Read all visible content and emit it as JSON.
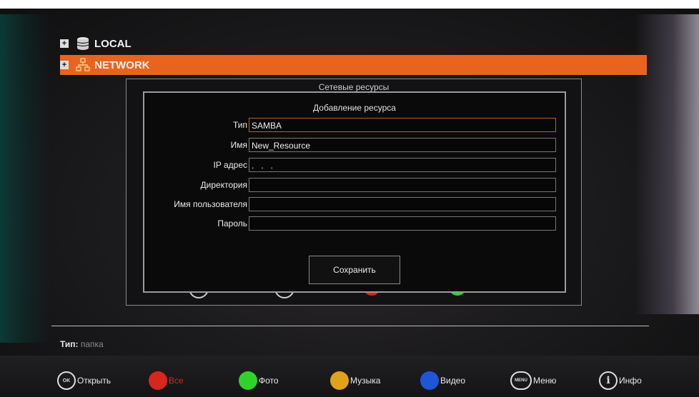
{
  "tree": {
    "local": {
      "label": "LOCAL",
      "icon": "database-icon"
    },
    "network": {
      "label": "NETWORK",
      "icon": "network-icon",
      "highlight_color": "#e8641e"
    }
  },
  "outer_dialog": {
    "title": "Сетевые ресурсы"
  },
  "dialog": {
    "title": "Добавление ресурса",
    "fields": [
      {
        "label": "Тип",
        "value": "SAMBA"
      },
      {
        "label": "Имя",
        "value": "New_Resource"
      },
      {
        "label": "IP адрес",
        "value": ".   .   ."
      },
      {
        "label": "Директория",
        "value": ""
      },
      {
        "label": "Имя пользователя",
        "value": ""
      },
      {
        "label": "Пароль",
        "value": ""
      }
    ],
    "save_label": "Сохранить"
  },
  "info": {
    "type_key": "Тип:",
    "type_value": "папка"
  },
  "bottom_bar": [
    {
      "id": "ok",
      "icon": "ok-button-icon",
      "glyph": "OK",
      "label": "Открыть"
    },
    {
      "id": "red",
      "icon": "red-button-icon",
      "color": "#d8261c",
      "label": "Все"
    },
    {
      "id": "green",
      "icon": "green-button-icon",
      "color": "#2fd42a",
      "label": "Фото"
    },
    {
      "id": "yellow",
      "icon": "yellow-button-icon",
      "color": "#e0a21a",
      "label": "Музыка"
    },
    {
      "id": "blue",
      "icon": "blue-button-icon",
      "color": "#1f56d8",
      "label": "Видео"
    },
    {
      "id": "menu",
      "icon": "menu-button-icon",
      "glyph": "MENU",
      "label": "Меню"
    },
    {
      "id": "info",
      "icon": "info-button-icon",
      "glyph": "i",
      "label": "Инфо"
    }
  ]
}
